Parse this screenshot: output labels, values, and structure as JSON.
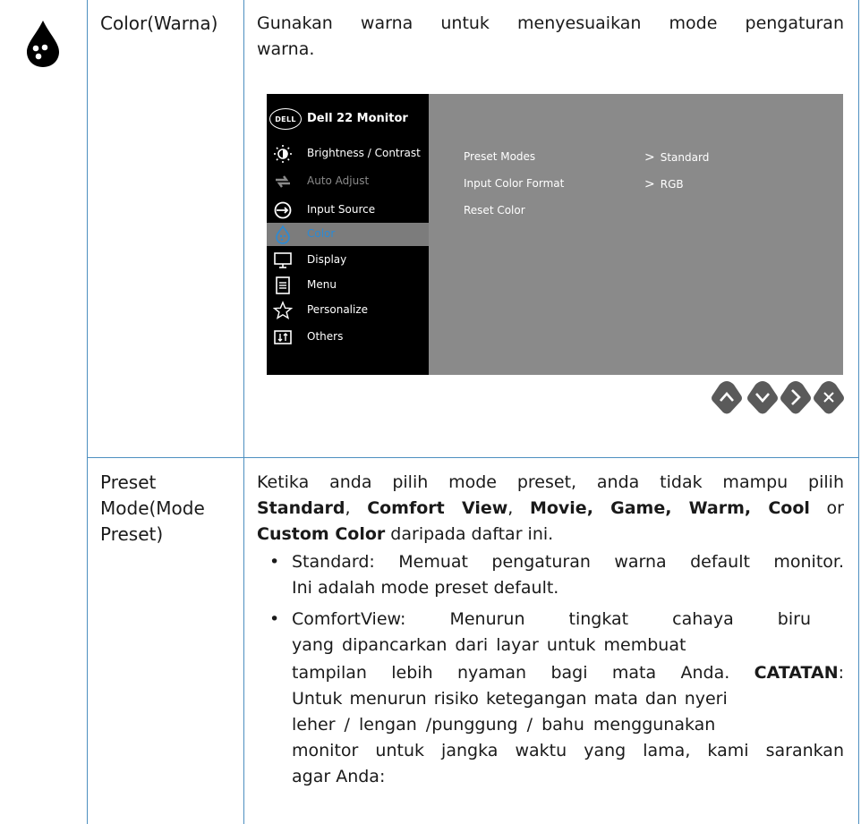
{
  "row1": {
    "label": "Color(Warna)",
    "desc_line1": "Gunakan warna untuk menyesuaikan mode pengaturan",
    "desc_line2": "warna."
  },
  "osd": {
    "logo": "DELL",
    "title": "Dell 22 Monitor",
    "menu": [
      {
        "label": "Brightness / Contrast",
        "icon": "brightness-icon"
      },
      {
        "label": "Auto Adjust",
        "icon": "auto-adjust-icon"
      },
      {
        "label": "Input Source",
        "icon": "input-source-icon"
      },
      {
        "label": "Color",
        "icon": "color-drop-icon"
      },
      {
        "label": "Display",
        "icon": "display-icon"
      },
      {
        "label": "Menu",
        "icon": "menu-icon"
      },
      {
        "label": "Personalize",
        "icon": "star-icon"
      },
      {
        "label": "Others",
        "icon": "others-icon"
      }
    ],
    "rows": [
      {
        "label": "Preset Modes",
        "value": "Standard"
      },
      {
        "label": "Input Color Format",
        "value": "RGB"
      },
      {
        "label": "Reset Color",
        "value": ""
      }
    ],
    "selected": "Color",
    "value_prefix": ">",
    "accent": "#2a8ad6",
    "nav_color": "#5a5a5a"
  },
  "row2": {
    "label_l1": "Preset",
    "label_l2": "Mode(Mode",
    "label_l3": "Preset)",
    "intro_l1": "Ketika anda pilih mode preset, anda tidak mampu pilih",
    "intro_l2_a": "Standard",
    "intro_l2_b": ", ",
    "intro_l2_c": "Comfort View",
    "intro_l2_d": ", ",
    "intro_l2_e": "Movie, Game, Warm, Cool",
    "intro_l2_f": " or",
    "intro_l3_a": "Custom Color",
    "intro_l3_b": " daripada daftar ini.",
    "bullet": "•",
    "b1_l1": "Standard: Memuat pengaturan warna default monitor.",
    "b1_l2": "Ini adalah mode preset default.",
    "b2_l1": "ComfortView: Menurun tingkat cahaya biru",
    "b2_l2": "yang dipancarkan dari layar untuk membuat",
    "b2_l3_a": "tampilan lebih nyaman bagi mata Anda. ",
    "b2_l3_b": "CATATAN",
    "b2_l3_c": ":",
    "b2_l4": "Untuk menurun risiko ketegangan mata dan nyeri",
    "b2_l5": "leher / lengan /punggung / bahu menggunakan",
    "b2_l6": "monitor untuk jangka waktu yang lama, kami sarankan",
    "b2_l7": "agar Anda:"
  }
}
